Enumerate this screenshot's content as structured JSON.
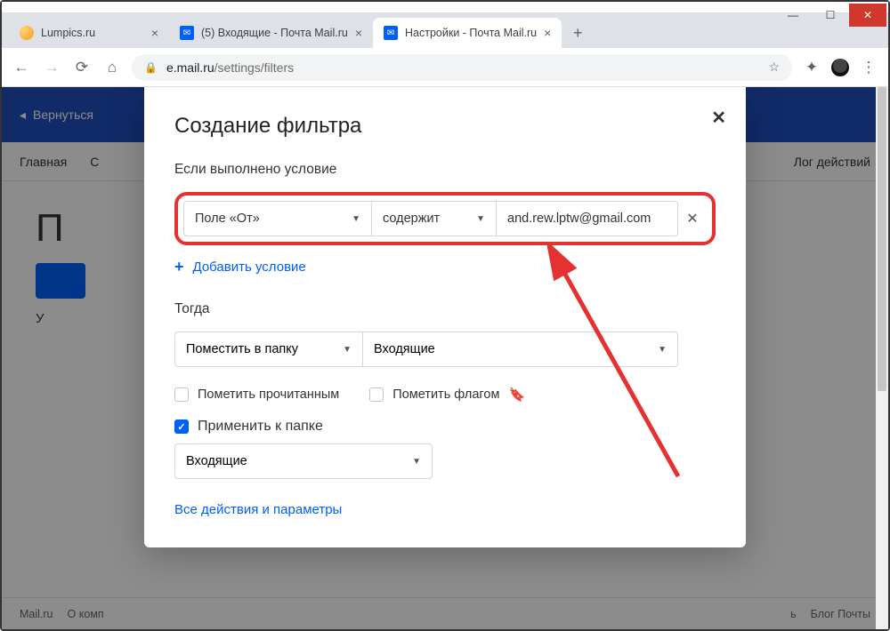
{
  "window": {
    "tabs": [
      {
        "title": "Lumpics.ru",
        "favicon": "orange",
        "active": false
      },
      {
        "title": "(5) Входящие - Почта Mail.ru",
        "favicon": "mail",
        "active": false
      },
      {
        "title": "Настройки - Почта Mail.ru",
        "favicon": "mail",
        "active": true
      }
    ],
    "url_host": "e.mail.ru",
    "url_path": "/settings/filters"
  },
  "page": {
    "back_label": "Вернуться",
    "nav_left": [
      "Главная",
      "С"
    ],
    "nav_right": "Лог действий",
    "left_letter": "П",
    "note": "У"
  },
  "modal": {
    "title": "Создание фильтра",
    "condition_header": "Если выполнено условие",
    "field_select": "Поле «От»",
    "op_select": "содержит",
    "value": "and.rew.lptw@gmail.com",
    "value_placeholder": "",
    "add_condition": "Добавить условие",
    "then_header": "Тогда",
    "action_select": "Поместить в папку",
    "action_folder": "Входящие",
    "check_read": "Пометить прочитанным",
    "check_flag": "Пометить флагом",
    "apply_to_folder": "Применить к папке",
    "apply_folder_value": "Входящие",
    "all_actions": "Все действия и параметры"
  },
  "footer": {
    "left": [
      "Mail.ru",
      "О комп"
    ],
    "right": [
      "ь",
      "Блог Почты"
    ]
  }
}
